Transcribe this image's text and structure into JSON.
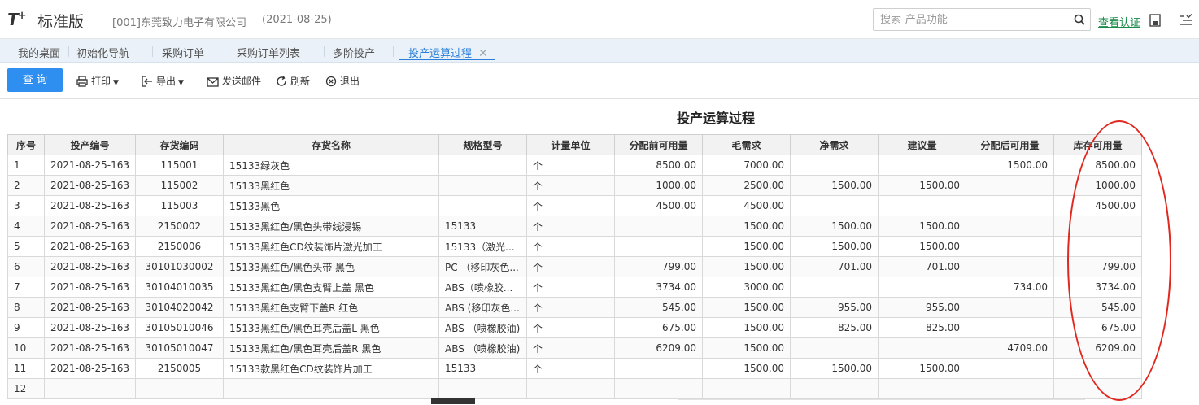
{
  "header": {
    "logo": "T",
    "logo_plus": "+",
    "edition": "标准版",
    "company": "[001]东莞致力电子有限公司",
    "date": "(2021-08-25)",
    "search_placeholder": "搜索-产品功能",
    "verify_link": "查看认证"
  },
  "tabs": [
    {
      "label": "我的桌面"
    },
    {
      "label": "初始化导航"
    },
    {
      "label": "采购订单"
    },
    {
      "label": "采购订单列表"
    },
    {
      "label": "多阶投产"
    },
    {
      "label": "投产运算过程",
      "active": true
    }
  ],
  "toolbar": {
    "query": "查 询",
    "print": "打印",
    "export": "导出",
    "send_mail": "发送邮件",
    "refresh": "刷新",
    "exit": "退出"
  },
  "report": {
    "title": "投产运算过程",
    "columns": [
      "序号",
      "投产编号",
      "存货编码",
      "存货名称",
      "规格型号",
      "计量单位",
      "分配前可用量",
      "毛需求",
      "净需求",
      "建议量",
      "分配后可用量",
      "库存可用量"
    ],
    "rows": [
      [
        "1",
        "2021-08-25-163",
        "115001",
        "15133绿灰色",
        "",
        "个",
        "8500.00",
        "7000.00",
        "",
        "",
        "1500.00",
        "8500.00"
      ],
      [
        "2",
        "2021-08-25-163",
        "115002",
        "15133黑红色",
        "",
        "个",
        "1000.00",
        "2500.00",
        "1500.00",
        "1500.00",
        "",
        "1000.00"
      ],
      [
        "3",
        "2021-08-25-163",
        "115003",
        "15133黑色",
        "",
        "个",
        "4500.00",
        "4500.00",
        "",
        "",
        "",
        "4500.00"
      ],
      [
        "4",
        "2021-08-25-163",
        "2150002",
        "15133黑红色/黑色头带线浸锡",
        "15133",
        "个",
        "",
        "1500.00",
        "1500.00",
        "1500.00",
        "",
        ""
      ],
      [
        "5",
        "2021-08-25-163",
        "2150006",
        "15133黑红色CD纹装饰片激光加工",
        "15133（激光...",
        "个",
        "",
        "1500.00",
        "1500.00",
        "1500.00",
        "",
        ""
      ],
      [
        "6",
        "2021-08-25-163",
        "30101030002",
        "15133黑红色/黑色头带 黑色",
        "PC （移印灰色...",
        "个",
        "799.00",
        "1500.00",
        "701.00",
        "701.00",
        "",
        "799.00"
      ],
      [
        "7",
        "2021-08-25-163",
        "30104010035",
        "15133黑红色/黑色支臂上盖 黑色",
        "ABS（喷橡胶...",
        "个",
        "3734.00",
        "3000.00",
        "",
        "",
        "734.00",
        "3734.00"
      ],
      [
        "8",
        "2021-08-25-163",
        "30104020042",
        "15133黑红色支臂下盖R 红色",
        "ABS (移印灰色...",
        "个",
        "545.00",
        "1500.00",
        "955.00",
        "955.00",
        "",
        "545.00"
      ],
      [
        "9",
        "2021-08-25-163",
        "30105010046",
        "15133黑红色/黑色耳壳后盖L 黑色",
        "ABS （喷橡胶油)",
        "个",
        "675.00",
        "1500.00",
        "825.00",
        "825.00",
        "",
        "675.00"
      ],
      [
        "10",
        "2021-08-25-163",
        "30105010047",
        "15133黑红色/黑色耳壳后盖R 黑色",
        "ABS （喷橡胶油)",
        "个",
        "6209.00",
        "1500.00",
        "",
        "",
        "4709.00",
        "6209.00"
      ],
      [
        "11",
        "2021-08-25-163",
        "2150005",
        "15133款黑红色CD纹装饰片加工",
        "15133",
        "个",
        "",
        "1500.00",
        "1500.00",
        "1500.00",
        "",
        ""
      ],
      [
        "12",
        "",
        "",
        "",
        "",
        "",
        "",
        "",
        "",
        "",
        "",
        ""
      ]
    ]
  },
  "colors": {
    "primary": "#2f8ff0",
    "tab_active": "#2a7fd8",
    "verify": "#1b8c4c",
    "annotation": "#e0281e"
  }
}
